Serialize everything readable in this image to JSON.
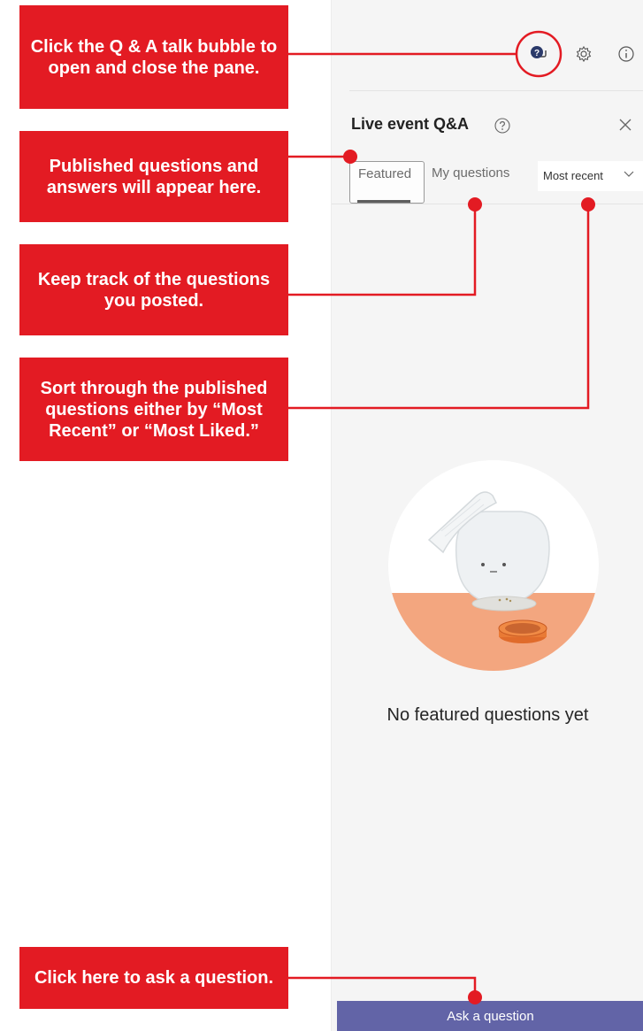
{
  "callouts": {
    "qa_toggle": "Click the Q & A talk bubble to open and close the pane.",
    "featured": "Published questions and answers will appear here.",
    "my_questions": "Keep track of the questions you posted.",
    "sort": "Sort through the published questions either by “Most Recent” or “Most Liked.”",
    "ask": "Click here to ask a question."
  },
  "pane": {
    "title": "Live event Q&A",
    "tabs": [
      {
        "label": "Featured",
        "selected": true
      },
      {
        "label": "My questions",
        "selected": false
      }
    ],
    "sort": {
      "selected": "Most recent"
    },
    "empty_state": "No featured questions yet",
    "ask_button": "Ask a question",
    "icons": [
      "qa-talk-bubble-icon",
      "gear-icon",
      "info-icon",
      "help-icon",
      "close-icon",
      "chevron-down-icon"
    ]
  },
  "colors": {
    "callout_red": "#e31b23",
    "accent_purple": "#6264a7",
    "illustration_orange": "#f3a67f"
  }
}
